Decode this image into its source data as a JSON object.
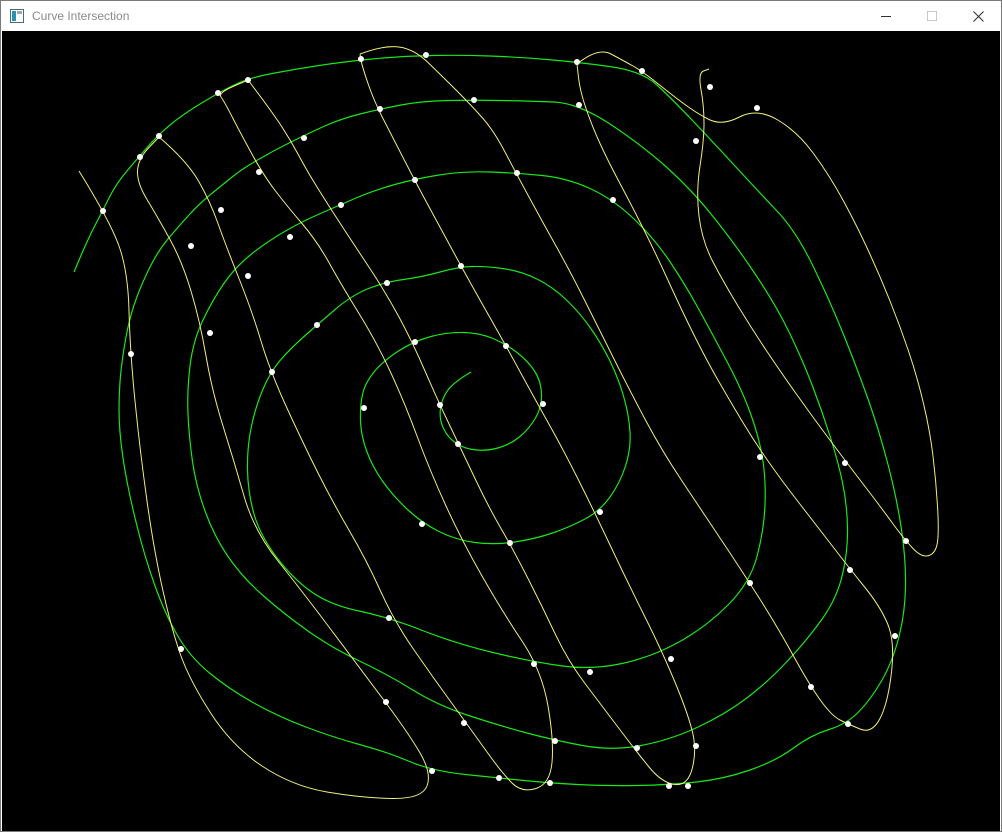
{
  "window": {
    "title": "Curve Intersection",
    "controls": [
      "minimize-icon",
      "maximize-icon",
      "close-icon"
    ]
  },
  "colors": {
    "background": "#000000",
    "spiral": "#19e619",
    "wave": "#f0f07a",
    "points": "#ffffff"
  },
  "icons": {
    "app": "app-window-icon"
  }
}
